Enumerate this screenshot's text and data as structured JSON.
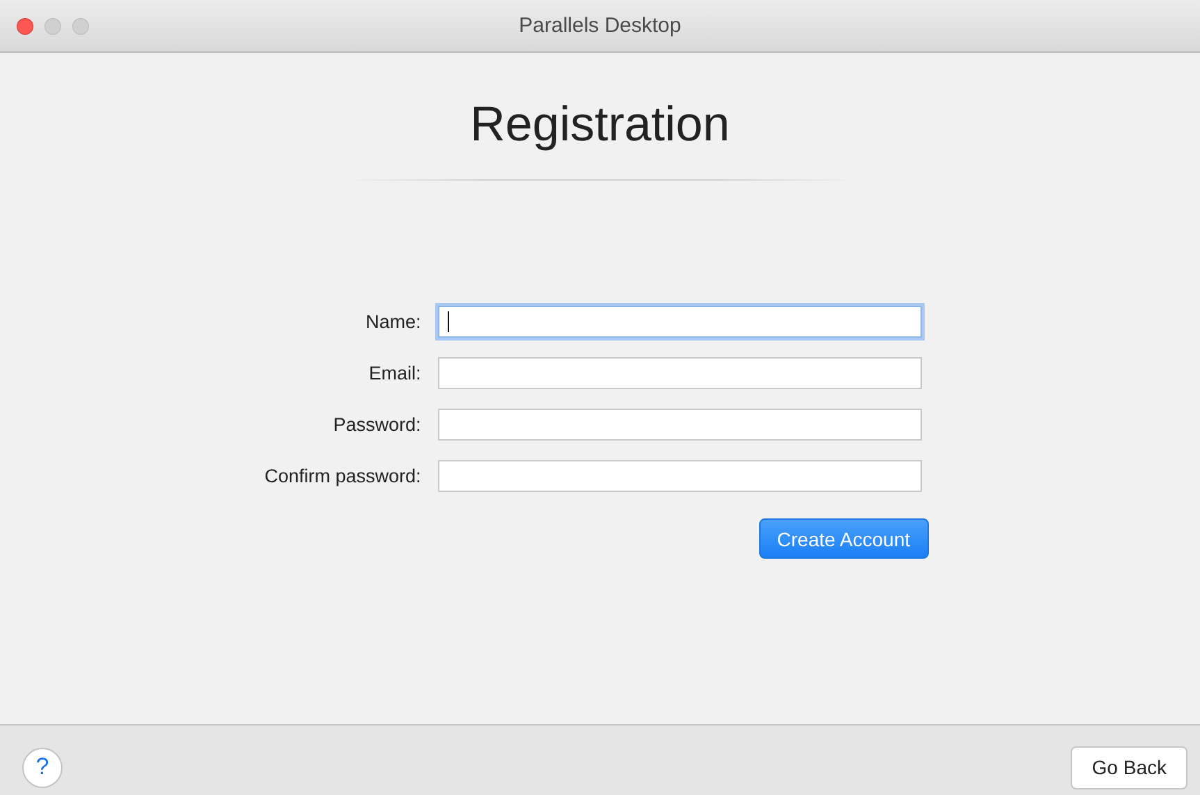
{
  "window": {
    "title": "Parallels Desktop"
  },
  "heading": "Registration",
  "fields": [
    {
      "label": "Name:",
      "focused": true
    },
    {
      "label": "Email:",
      "focused": false
    },
    {
      "label": "Password:",
      "focused": false
    },
    {
      "label": "Confirm password:",
      "focused": false
    }
  ],
  "primary_button": "Create Account",
  "help_button": "?",
  "back_button": "Go Back"
}
